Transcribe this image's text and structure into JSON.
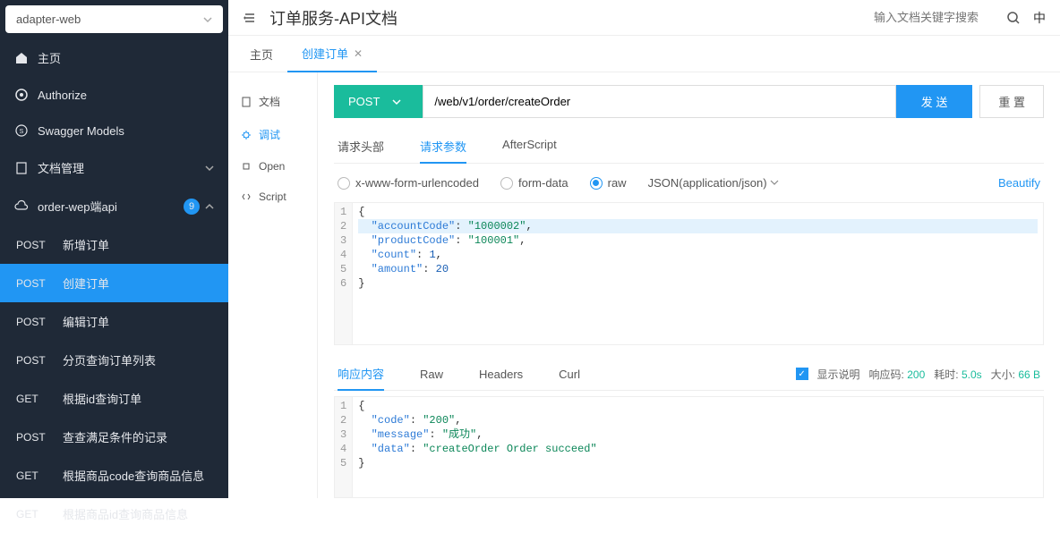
{
  "project": {
    "name": "adapter-web"
  },
  "sidebar": {
    "home": "主页",
    "authorize": "Authorize",
    "swagger": "Swagger Models",
    "docManage": "文档管理",
    "apiGroup": {
      "label": "order-wep端api",
      "badge": "9"
    },
    "items": [
      {
        "method": "POST",
        "label": "新增订单"
      },
      {
        "method": "POST",
        "label": "创建订单"
      },
      {
        "method": "POST",
        "label": "编辑订单"
      },
      {
        "method": "POST",
        "label": "分页查询订单列表"
      },
      {
        "method": "GET",
        "label": "根据id查询订单"
      },
      {
        "method": "POST",
        "label": "查查满足条件的记录"
      },
      {
        "method": "GET",
        "label": "根据商品code查询商品信息"
      },
      {
        "method": "GET",
        "label": "根据商品id查询商品信息"
      }
    ]
  },
  "header": {
    "title": "订单服务-API文档",
    "searchPlaceholder": "输入文档关键字搜索",
    "lang": "中"
  },
  "tabs": {
    "home": "主页",
    "create": "创建订单"
  },
  "leftPanel": {
    "doc": "文档",
    "debug": "调试",
    "open": "Open",
    "script": "Script"
  },
  "request": {
    "method": "POST",
    "url": "/web/v1/order/createOrder",
    "send": "发 送",
    "reset": "重 置"
  },
  "paramTabs": {
    "headers": "请求头部",
    "params": "请求参数",
    "after": "AfterScript"
  },
  "bodyTypes": {
    "urlencoded": "x-www-form-urlencoded",
    "formdata": "form-data",
    "raw": "raw",
    "json": "JSON(application/json)",
    "beautify": "Beautify"
  },
  "requestBody": {
    "lines": [
      "{",
      "  \"accountCode\": \"1000002\",",
      "  \"productCode\": \"100001\",",
      "  \"count\": 1,",
      "  \"amount\": 20",
      "}"
    ]
  },
  "responseTabs": {
    "content": "响应内容",
    "raw": "Raw",
    "headers": "Headers",
    "curl": "Curl"
  },
  "responseMeta": {
    "showDesc": "显示说明",
    "codeLabel": "响应码:",
    "code": "200",
    "timeLabel": "耗时:",
    "time": "5.0s",
    "sizeLabel": "大小:",
    "size": "66 B"
  },
  "responseBody": {
    "lines": [
      "{",
      "  \"code\": \"200\",",
      "  \"message\": \"成功\",",
      "  \"data\": \"createOrder Order succeed\"",
      "}"
    ]
  }
}
